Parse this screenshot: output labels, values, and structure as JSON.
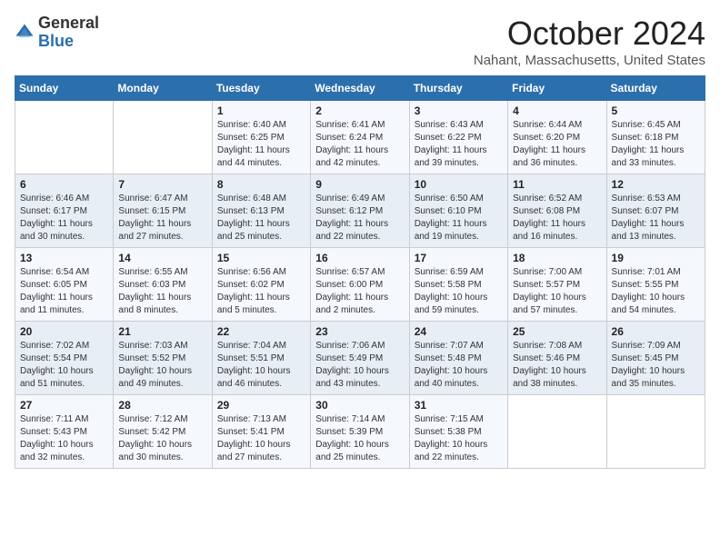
{
  "logo": {
    "general": "General",
    "blue": "Blue"
  },
  "header": {
    "month": "October 2024",
    "location": "Nahant, Massachusetts, United States"
  },
  "weekdays": [
    "Sunday",
    "Monday",
    "Tuesday",
    "Wednesday",
    "Thursday",
    "Friday",
    "Saturday"
  ],
  "weeks": [
    [
      {
        "day": "",
        "info": ""
      },
      {
        "day": "",
        "info": ""
      },
      {
        "day": "1",
        "info": "Sunrise: 6:40 AM\nSunset: 6:25 PM\nDaylight: 11 hours and 44 minutes."
      },
      {
        "day": "2",
        "info": "Sunrise: 6:41 AM\nSunset: 6:24 PM\nDaylight: 11 hours and 42 minutes."
      },
      {
        "day": "3",
        "info": "Sunrise: 6:43 AM\nSunset: 6:22 PM\nDaylight: 11 hours and 39 minutes."
      },
      {
        "day": "4",
        "info": "Sunrise: 6:44 AM\nSunset: 6:20 PM\nDaylight: 11 hours and 36 minutes."
      },
      {
        "day": "5",
        "info": "Sunrise: 6:45 AM\nSunset: 6:18 PM\nDaylight: 11 hours and 33 minutes."
      }
    ],
    [
      {
        "day": "6",
        "info": "Sunrise: 6:46 AM\nSunset: 6:17 PM\nDaylight: 11 hours and 30 minutes."
      },
      {
        "day": "7",
        "info": "Sunrise: 6:47 AM\nSunset: 6:15 PM\nDaylight: 11 hours and 27 minutes."
      },
      {
        "day": "8",
        "info": "Sunrise: 6:48 AM\nSunset: 6:13 PM\nDaylight: 11 hours and 25 minutes."
      },
      {
        "day": "9",
        "info": "Sunrise: 6:49 AM\nSunset: 6:12 PM\nDaylight: 11 hours and 22 minutes."
      },
      {
        "day": "10",
        "info": "Sunrise: 6:50 AM\nSunset: 6:10 PM\nDaylight: 11 hours and 19 minutes."
      },
      {
        "day": "11",
        "info": "Sunrise: 6:52 AM\nSunset: 6:08 PM\nDaylight: 11 hours and 16 minutes."
      },
      {
        "day": "12",
        "info": "Sunrise: 6:53 AM\nSunset: 6:07 PM\nDaylight: 11 hours and 13 minutes."
      }
    ],
    [
      {
        "day": "13",
        "info": "Sunrise: 6:54 AM\nSunset: 6:05 PM\nDaylight: 11 hours and 11 minutes."
      },
      {
        "day": "14",
        "info": "Sunrise: 6:55 AM\nSunset: 6:03 PM\nDaylight: 11 hours and 8 minutes."
      },
      {
        "day": "15",
        "info": "Sunrise: 6:56 AM\nSunset: 6:02 PM\nDaylight: 11 hours and 5 minutes."
      },
      {
        "day": "16",
        "info": "Sunrise: 6:57 AM\nSunset: 6:00 PM\nDaylight: 11 hours and 2 minutes."
      },
      {
        "day": "17",
        "info": "Sunrise: 6:59 AM\nSunset: 5:58 PM\nDaylight: 10 hours and 59 minutes."
      },
      {
        "day": "18",
        "info": "Sunrise: 7:00 AM\nSunset: 5:57 PM\nDaylight: 10 hours and 57 minutes."
      },
      {
        "day": "19",
        "info": "Sunrise: 7:01 AM\nSunset: 5:55 PM\nDaylight: 10 hours and 54 minutes."
      }
    ],
    [
      {
        "day": "20",
        "info": "Sunrise: 7:02 AM\nSunset: 5:54 PM\nDaylight: 10 hours and 51 minutes."
      },
      {
        "day": "21",
        "info": "Sunrise: 7:03 AM\nSunset: 5:52 PM\nDaylight: 10 hours and 49 minutes."
      },
      {
        "day": "22",
        "info": "Sunrise: 7:04 AM\nSunset: 5:51 PM\nDaylight: 10 hours and 46 minutes."
      },
      {
        "day": "23",
        "info": "Sunrise: 7:06 AM\nSunset: 5:49 PM\nDaylight: 10 hours and 43 minutes."
      },
      {
        "day": "24",
        "info": "Sunrise: 7:07 AM\nSunset: 5:48 PM\nDaylight: 10 hours and 40 minutes."
      },
      {
        "day": "25",
        "info": "Sunrise: 7:08 AM\nSunset: 5:46 PM\nDaylight: 10 hours and 38 minutes."
      },
      {
        "day": "26",
        "info": "Sunrise: 7:09 AM\nSunset: 5:45 PM\nDaylight: 10 hours and 35 minutes."
      }
    ],
    [
      {
        "day": "27",
        "info": "Sunrise: 7:11 AM\nSunset: 5:43 PM\nDaylight: 10 hours and 32 minutes."
      },
      {
        "day": "28",
        "info": "Sunrise: 7:12 AM\nSunset: 5:42 PM\nDaylight: 10 hours and 30 minutes."
      },
      {
        "day": "29",
        "info": "Sunrise: 7:13 AM\nSunset: 5:41 PM\nDaylight: 10 hours and 27 minutes."
      },
      {
        "day": "30",
        "info": "Sunrise: 7:14 AM\nSunset: 5:39 PM\nDaylight: 10 hours and 25 minutes."
      },
      {
        "day": "31",
        "info": "Sunrise: 7:15 AM\nSunset: 5:38 PM\nDaylight: 10 hours and 22 minutes."
      },
      {
        "day": "",
        "info": ""
      },
      {
        "day": "",
        "info": ""
      }
    ]
  ]
}
